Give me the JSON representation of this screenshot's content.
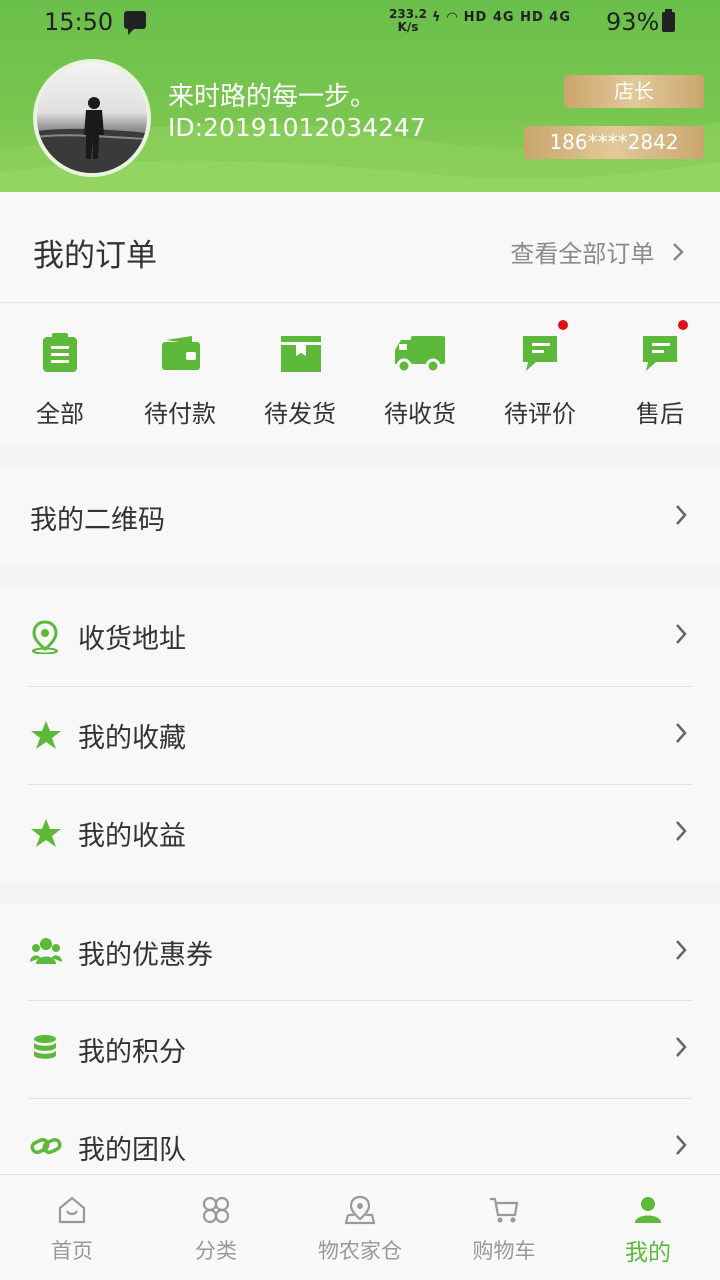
{
  "status_bar": {
    "time": "15:50",
    "net_speed_value": "233.2",
    "net_speed_unit": "K/s",
    "signal_text": "HD 4G  HD 4G",
    "battery": "93%"
  },
  "profile": {
    "name": "来时路的每一步。",
    "id": "ID:20191012034247",
    "role": "店长",
    "phone": "186****2842"
  },
  "orders": {
    "title": "我的订单",
    "view_all": "查看全部订单",
    "items": [
      {
        "label": "全部",
        "icon": "clipboard-icon",
        "dot": false
      },
      {
        "label": "待付款",
        "icon": "wallet-icon",
        "dot": false
      },
      {
        "label": "待发货",
        "icon": "box-icon",
        "dot": false
      },
      {
        "label": "待收货",
        "icon": "truck-icon",
        "dot": false
      },
      {
        "label": "待评价",
        "icon": "comment-icon",
        "dot": true
      },
      {
        "label": "售后",
        "icon": "service-icon",
        "dot": true
      }
    ]
  },
  "menu": {
    "qrcode": "我的二维码",
    "address": "收货地址",
    "favorites": "我的收藏",
    "earnings": "我的收益",
    "coupons": "我的优惠券",
    "points": "我的积分",
    "team": "我的团队"
  },
  "tabbar": {
    "home": "首页",
    "category": "分类",
    "warehouse": "物农家仓",
    "cart": "购物车",
    "mine": "我的"
  },
  "colors": {
    "brand_green": "#5cb93a",
    "header_green": "#72c24e",
    "gold": "#d9b981",
    "dot_red": "#e0101a"
  }
}
